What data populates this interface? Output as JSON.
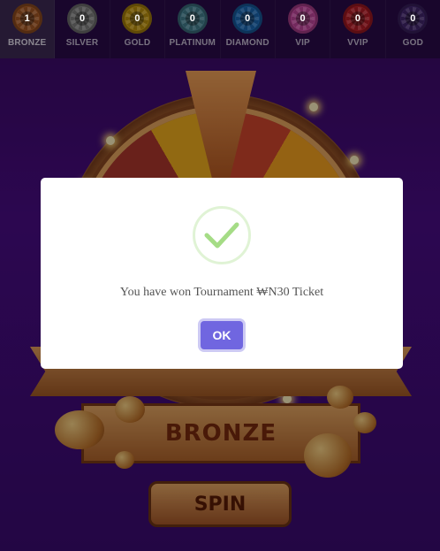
{
  "tiers": [
    {
      "label": "BRONZE",
      "count": "1",
      "color": "#b8632a",
      "active": true
    },
    {
      "label": "SILVER",
      "count": "0",
      "color": "#8f8f8f",
      "active": false
    },
    {
      "label": "GOLD",
      "count": "0",
      "color": "#d4a312",
      "active": false
    },
    {
      "label": "PLATINUM",
      "count": "0",
      "color": "#4d8ea0",
      "active": false
    },
    {
      "label": "DIAMOND",
      "count": "0",
      "color": "#1f74c7",
      "active": false
    },
    {
      "label": "VIP",
      "count": "0",
      "color": "#d94fb0",
      "active": false
    },
    {
      "label": "VVIP",
      "count": "0",
      "color": "#c8212c",
      "active": false
    },
    {
      "label": "GOD",
      "count": "0",
      "color": "#4a2a7a",
      "active": false
    }
  ],
  "wheel": {
    "tier_name": "BRONZE",
    "spin_label": "SPIN"
  },
  "modal": {
    "message": "You have won Tournament ₩N30 Ticket",
    "ok_label": "OK",
    "icon": "success-check-icon"
  }
}
